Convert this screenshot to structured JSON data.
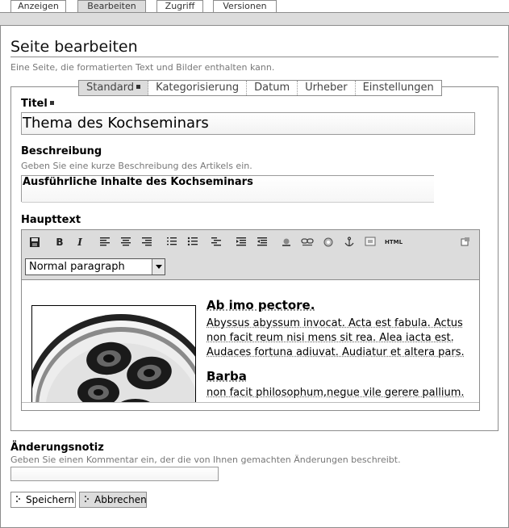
{
  "top_tabs": [
    {
      "label": "Anzeigen",
      "active": false
    },
    {
      "label": "Bearbeiten",
      "active": true
    },
    {
      "label": "Zugriff",
      "active": false
    },
    {
      "label": "Versionen",
      "active": false
    }
  ],
  "page": {
    "title": "Seite bearbeiten",
    "description": "Eine Seite, die formatierten Text und Bilder enthalten kann."
  },
  "sub_tabs": [
    {
      "label": "Standard",
      "active": true,
      "required_marker": true
    },
    {
      "label": "Kategorisierung",
      "active": false
    },
    {
      "label": "Datum",
      "active": false
    },
    {
      "label": "Urheber",
      "active": false
    },
    {
      "label": "Einstellungen",
      "active": false
    }
  ],
  "fields": {
    "title_label": "Titel",
    "title_value": "Thema des Kochseminars",
    "description_label": "Beschreibung",
    "description_help": "Geben Sie eine kurze Beschreibung des Artikels ein.",
    "description_value": "Ausführliche Inhalte des Kochseminars",
    "body_label": "Haupttext"
  },
  "editor": {
    "toolbar_icons": [
      "save-icon",
      "bold-icon",
      "italic-icon",
      "align-left-icon",
      "align-center-icon",
      "align-right-icon",
      "ordered-list-icon",
      "unordered-list-icon",
      "definition-list-icon",
      "outdent-icon",
      "indent-icon",
      "image-icon",
      "link-icon",
      "external-link-icon",
      "anchor-icon",
      "table-icon",
      "html-icon",
      "fullscreen-icon"
    ],
    "bold_glyph": "B",
    "italic_glyph": "I",
    "html_glyph": "HTML",
    "format_selected": "Normal paragraph",
    "content": {
      "heading1": "Ab imo pectore.",
      "paragraph1": "Abyssus abyssum invocat. Acta est fabula. Actus non facit reum nisi mens sit rea. Alea iacta est. Audaces fortuna adiuvat. Audiatur et altera pars.",
      "heading2": "Barba",
      "paragraph2": "non facit philosophum,negue vile gerere pallium."
    }
  },
  "change_note": {
    "label": "Änderungsnotiz",
    "help": "Geben Sie einen Kommentar ein, der die von Ihnen gemachten Änderungen beschreibt.",
    "value": ""
  },
  "buttons": {
    "save_label": "Speichern",
    "cancel_label": "Abbrechen"
  }
}
